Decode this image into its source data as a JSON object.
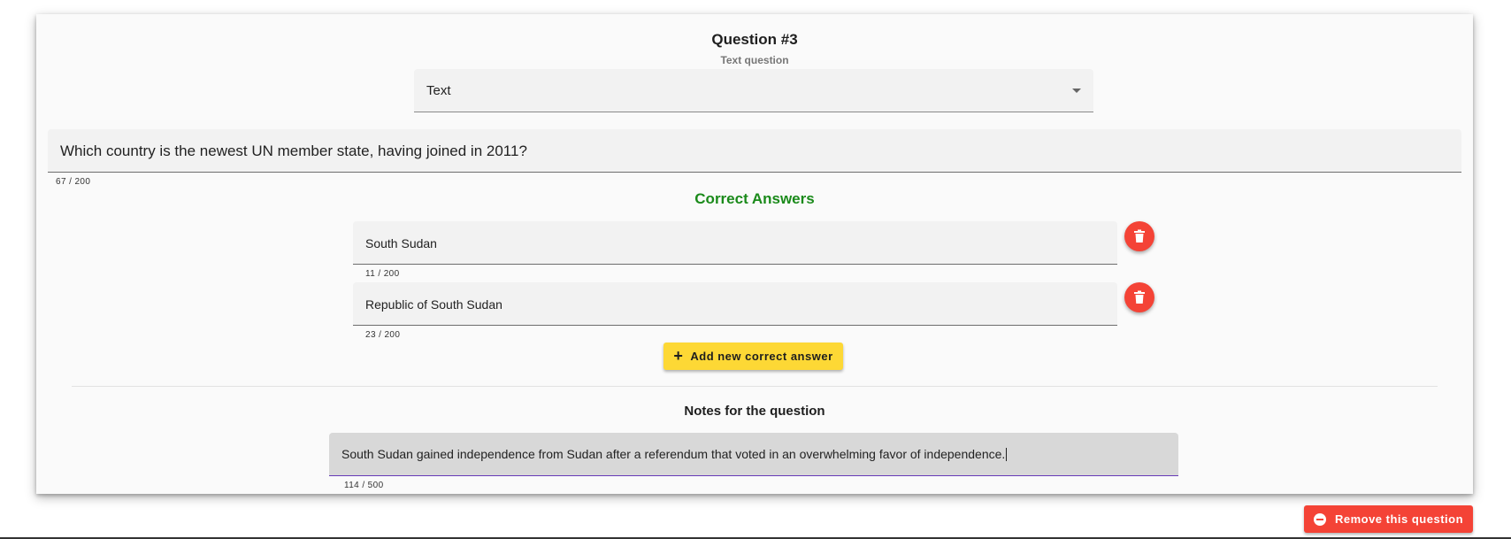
{
  "question": {
    "title": "Question #3",
    "subtitle": "Text question",
    "type_select": {
      "value": "Text"
    },
    "text": "Which country is the newest UN member state, having joined in 2011?",
    "text_counter": "67 / 200"
  },
  "correct_answers": {
    "heading": "Correct Answers",
    "items": [
      {
        "value": "South Sudan",
        "counter": "11 / 200",
        "delete_icon": "trash-icon"
      },
      {
        "value": "Republic of South Sudan",
        "counter": "23 / 200",
        "delete_icon": "trash-icon"
      }
    ],
    "add_button_label": "Add new correct answer"
  },
  "notes": {
    "heading": "Notes for the question",
    "value": "South Sudan gained independence from Sudan after a referendum that voted in an overwhelming favor of independence.",
    "counter": "114 / 500"
  },
  "remove_button_label": "Remove this question",
  "colors": {
    "accent_green": "#1a8a1a",
    "delete_red": "#f44336",
    "add_yellow": "#fdd835",
    "focus_purple": "#673ab7"
  }
}
